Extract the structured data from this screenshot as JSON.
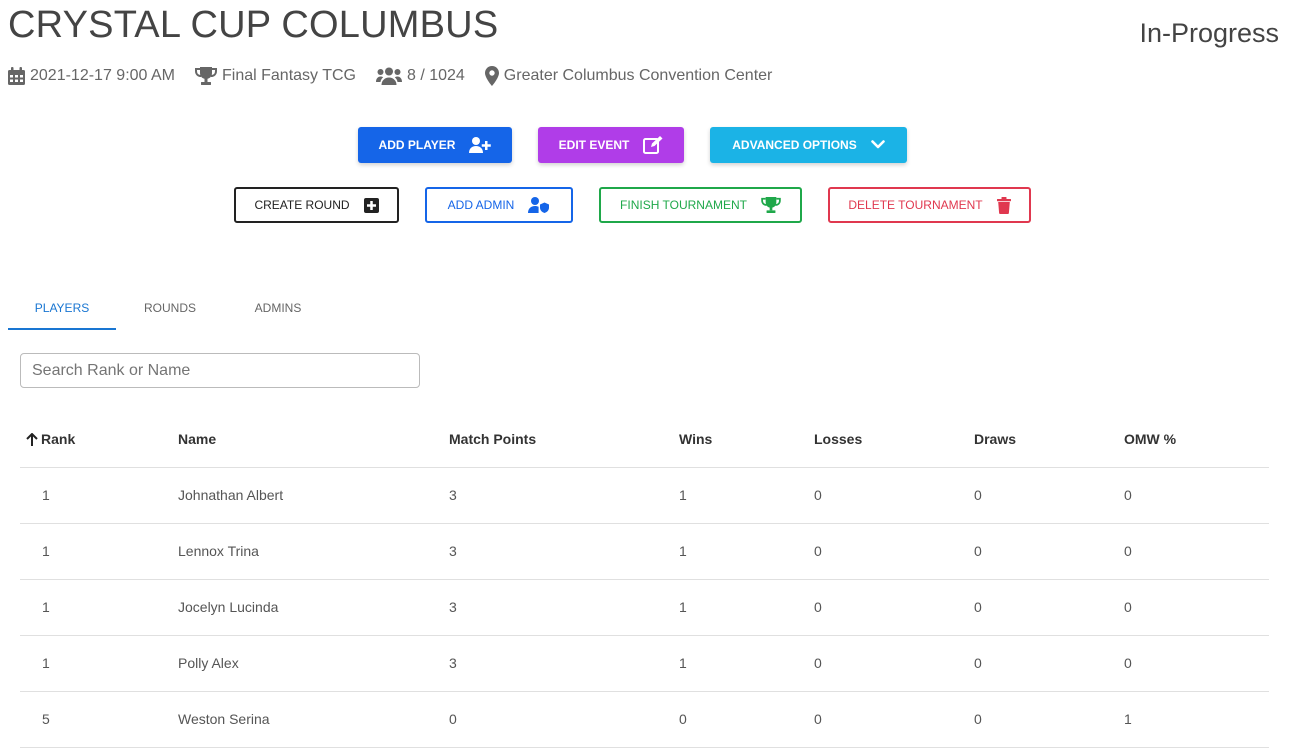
{
  "header": {
    "title": "CRYSTAL CUP COLUMBUS",
    "status": "In-Progress"
  },
  "meta": {
    "datetime": "2021-12-17 9:00 AM",
    "game": "Final Fantasy TCG",
    "players": "8 / 1024",
    "location": "Greater Columbus Convention Center"
  },
  "actions": {
    "add_player": "ADD PLAYER",
    "edit_event": "EDIT EVENT",
    "advanced_options": "ADVANCED OPTIONS",
    "create_round": "CREATE ROUND",
    "add_admin": "ADD ADMIN",
    "finish_tournament": "FINISH TOURNAMENT",
    "delete_tournament": "DELETE TOURNAMENT"
  },
  "colors": {
    "primary": "#1976d2",
    "add_player": "#1565e8",
    "edit_event": "#b03de8",
    "advanced": "#1bb3e6",
    "finish": "#1fa84a",
    "delete": "#e0384f",
    "create": "#222222"
  },
  "tabs": [
    {
      "label": "PLAYERS",
      "active": true
    },
    {
      "label": "ROUNDS",
      "active": false
    },
    {
      "label": "ADMINS",
      "active": false
    }
  ],
  "search": {
    "placeholder": "Search Rank or Name",
    "value": ""
  },
  "table": {
    "columns": [
      "Rank",
      "Name",
      "Match Points",
      "Wins",
      "Losses",
      "Draws",
      "OMW %"
    ],
    "rows": [
      [
        "1",
        "Johnathan Albert",
        "3",
        "1",
        "0",
        "0",
        "0"
      ],
      [
        "1",
        "Lennox Trina",
        "3",
        "1",
        "0",
        "0",
        "0"
      ],
      [
        "1",
        "Jocelyn Lucinda",
        "3",
        "1",
        "0",
        "0",
        "0"
      ],
      [
        "1",
        "Polly Alex",
        "3",
        "1",
        "0",
        "0",
        "0"
      ],
      [
        "5",
        "Weston Serina",
        "0",
        "0",
        "0",
        "0",
        "1"
      ]
    ]
  }
}
